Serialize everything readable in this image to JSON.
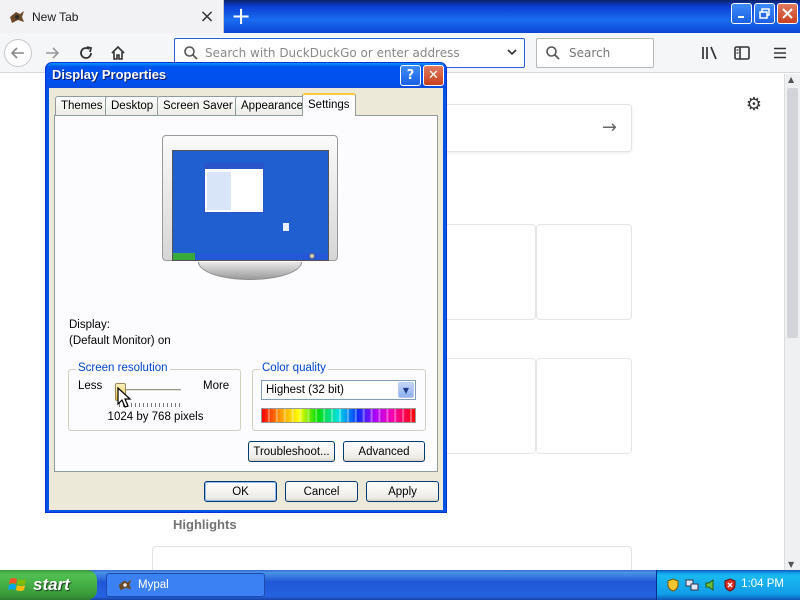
{
  "browser": {
    "tab_title": "New Tab",
    "new_tab_symbol": "+",
    "url_placeholder": "Search with DuckDuckGo or enter address",
    "search_placeholder": "Search"
  },
  "page": {
    "highlights_label": "Highlights"
  },
  "dialog": {
    "title": "Display Properties",
    "help_symbol": "?",
    "close_symbol": "✕",
    "tabs": [
      "Themes",
      "Desktop",
      "Screen Saver",
      "Appearance",
      "Settings"
    ],
    "active_tab": "Settings",
    "display_label": "Display:",
    "display_value": "(Default Monitor) on",
    "screen_resolution": {
      "title": "Screen resolution",
      "less_label": "Less",
      "more_label": "More",
      "value_text": "1024 by 768 pixels",
      "slider_fraction": 0.08
    },
    "color_quality": {
      "title": "Color quality",
      "selected": "Highest (32 bit)"
    },
    "buttons": {
      "troubleshoot": "Troubleshoot...",
      "advanced": "Advanced",
      "ok": "OK",
      "cancel": "Cancel",
      "apply": "Apply"
    }
  },
  "taskbar": {
    "start_label": "start",
    "task_label": "Mypal",
    "clock": "1:04 PM"
  },
  "colors": {
    "xp_blue": "#0054e3",
    "dialog_face": "#ece9d8",
    "group_title": "#0046d5",
    "start_green": "#3c9b3c"
  },
  "icons": {
    "tab": "mypal-icon",
    "back": "back-arrow-icon",
    "forward": "forward-arrow-icon",
    "reload": "reload-icon",
    "home": "home-icon",
    "library": "library-icon",
    "sidebar": "sidebar-icon",
    "menu": "hamburger-menu-icon",
    "settings": "gear-icon"
  }
}
